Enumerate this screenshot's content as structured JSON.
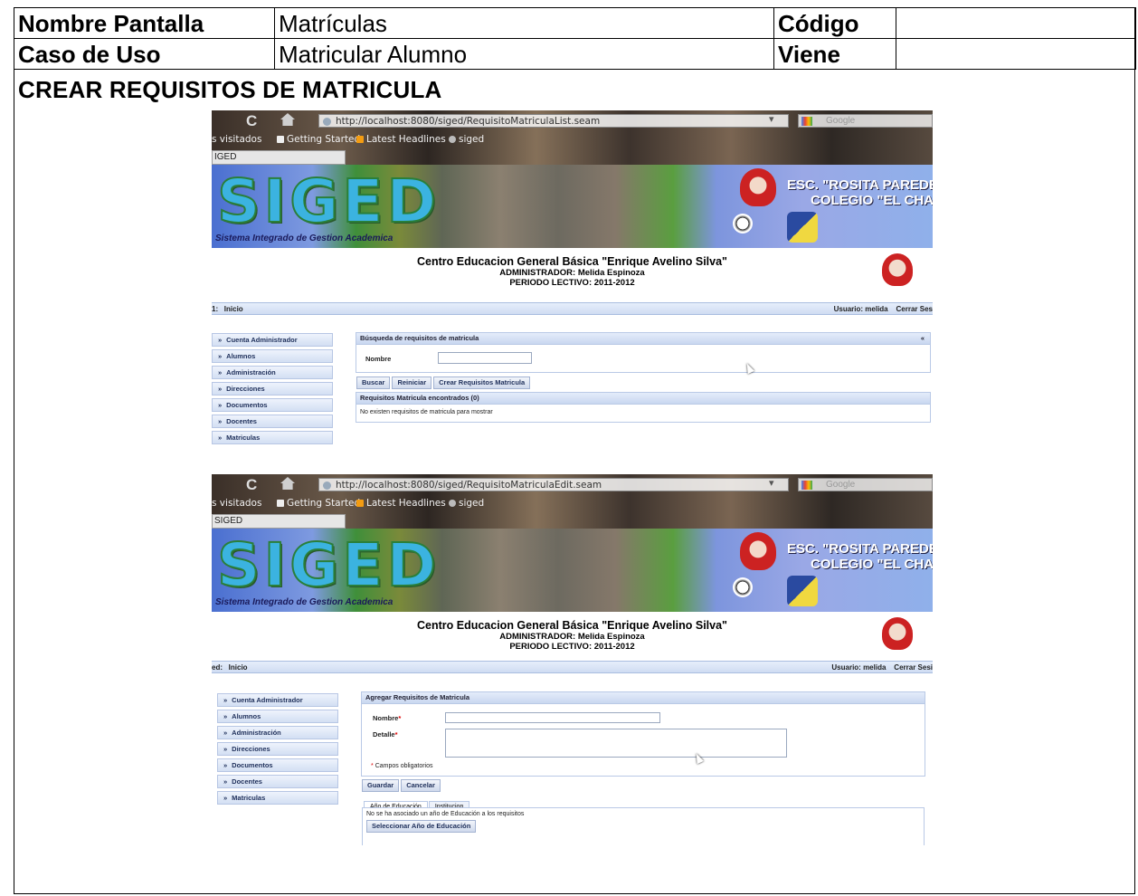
{
  "doc_header": {
    "nombre_pantalla_label": "Nombre Pantalla",
    "nombre_pantalla_value": "Matrículas",
    "codigo_label": "Código",
    "codigo_value": "",
    "caso_uso_label": "Caso de Uso",
    "caso_uso_value": "Matricular Alumno",
    "viene_label": "Viene",
    "viene_value": ""
  },
  "section_title": "CREAR REQUISITOS DE MATRICULA",
  "browser": {
    "back_glyph": "C",
    "search_placeholder": "Google",
    "bookmarks": [
      "s visitados",
      "Getting Started",
      "Latest Headlines",
      "siged"
    ],
    "bookmarks2": [
      "s visitados",
      "Getting Started",
      "Latest Headlines",
      "siged"
    ],
    "tab_title": "IGED",
    "tab_title2": "SIGED"
  },
  "banner": {
    "logo": "SIGED",
    "tagline": "Sistema Integrado de Gestion Academica",
    "school_line1": "ESC. \"ROSITA PAREDE",
    "school_line2": "COLEGIO \"EL CHAC"
  },
  "institution": {
    "name": "Centro Educacion General Básica \"Enrique Avelino Silva\"",
    "admin": "ADMINISTRADOR: Melida Espinoza",
    "periodo": "PERIODO LECTIVO: 2011-2012"
  },
  "menu": [
    "Cuenta Administrador",
    "Alumnos",
    "Administración",
    "Direcciones",
    "Documentos",
    "Docentes",
    "Matriculas"
  ],
  "shot1": {
    "url": "http://localhost:8080/siged/RequisitoMatriculaList.seam",
    "crumb_prefix": "1:",
    "crumb": "Inicio",
    "usuario": "Usuario: melida",
    "cerrar": "Cerrar Ses",
    "search_panel_title": "Búsqueda de requisitos de matricula",
    "collapse_glyph": "«",
    "nombre_label": "Nombre",
    "nombre_value": "",
    "btn_buscar": "Buscar",
    "btn_reiniciar": "Reiniciar",
    "btn_crear": "Crear Requisitos Matricula",
    "results_title": "Requisitos Matricula encontrados (0)",
    "no_results": "No existen requisitos de matricula para mostrar"
  },
  "shot2": {
    "url": "http://localhost:8080/siged/RequisitoMatriculaEdit.seam",
    "crumb_prefix": "ed:",
    "crumb": "Inicio",
    "usuario": "Usuario: melida",
    "cerrar": "Cerrar Sesi",
    "form_title": "Agregar Requisitos de Matricula",
    "nombre_label": "Nombre",
    "detalle_label": "Detalle",
    "required_mark": "*",
    "campos_obligatorios": "Campos obligatorios",
    "btn_guardar": "Guardar",
    "btn_cancelar": "Cancelar",
    "tab_anio": "Año de Educación",
    "tab_institucion": "Institucion",
    "no_anio": "No se ha asociado un año de Educación a los requisitos",
    "btn_seleccionar": "Seleccionar Año de Educación"
  }
}
